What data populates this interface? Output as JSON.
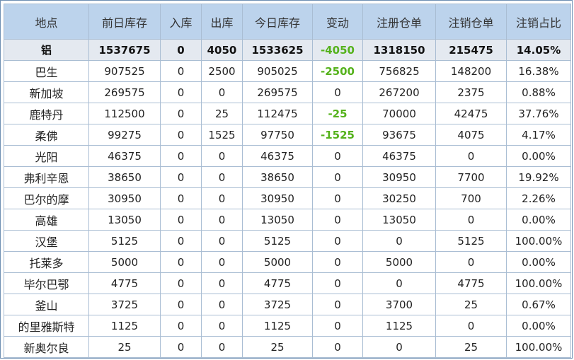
{
  "table": {
    "headers": [
      "地点",
      "前日库存",
      "入库",
      "出库",
      "今日库存",
      "变动",
      "注册仓单",
      "注销仓单",
      "注销占比"
    ],
    "rows": [
      [
        "铝",
        "1537675",
        "0",
        "4050",
        "1533625",
        "-4050",
        "1318150",
        "215475",
        "14.05%"
      ],
      [
        "巴生",
        "907525",
        "0",
        "2500",
        "905025",
        "-2500",
        "756825",
        "148200",
        "16.38%"
      ],
      [
        "新加坡",
        "269575",
        "0",
        "0",
        "269575",
        "0",
        "267200",
        "2375",
        "0.88%"
      ],
      [
        "鹿特丹",
        "112500",
        "0",
        "25",
        "112475",
        "-25",
        "70000",
        "42475",
        "37.76%"
      ],
      [
        "柔佛",
        "99275",
        "0",
        "1525",
        "97750",
        "-1525",
        "93675",
        "4075",
        "4.17%"
      ],
      [
        "光阳",
        "46375",
        "0",
        "0",
        "46375",
        "0",
        "46375",
        "0",
        "0.00%"
      ],
      [
        "弗利辛恩",
        "38650",
        "0",
        "0",
        "38650",
        "0",
        "30950",
        "7700",
        "19.92%"
      ],
      [
        "巴尔的摩",
        "30950",
        "0",
        "0",
        "30950",
        "0",
        "30250",
        "700",
        "2.26%"
      ],
      [
        "高雄",
        "13050",
        "0",
        "0",
        "13050",
        "0",
        "13050",
        "0",
        "0.00%"
      ],
      [
        "汉堡",
        "5125",
        "0",
        "0",
        "5125",
        "0",
        "0",
        "5125",
        "100.00%"
      ],
      [
        "托莱多",
        "5000",
        "0",
        "0",
        "5000",
        "0",
        "5000",
        "0",
        "0.00%"
      ],
      [
        "毕尔巴鄂",
        "4775",
        "0",
        "0",
        "4775",
        "0",
        "0",
        "4775",
        "100.00%"
      ],
      [
        "釜山",
        "3725",
        "0",
        "0",
        "3725",
        "0",
        "3700",
        "25",
        "0.67%"
      ],
      [
        "的里雅斯特",
        "1125",
        "0",
        "0",
        "1125",
        "0",
        "1125",
        "0",
        "0.00%"
      ],
      [
        "新奥尔良",
        "25",
        "0",
        "0",
        "25",
        "0",
        "0",
        "25",
        "100.00%"
      ]
    ],
    "colors": {
      "header_bg": "#bcd3ec",
      "total_row_bg": "#e4e9f0",
      "border": "#a9bdd3",
      "negative_change": "#55b21c"
    }
  }
}
